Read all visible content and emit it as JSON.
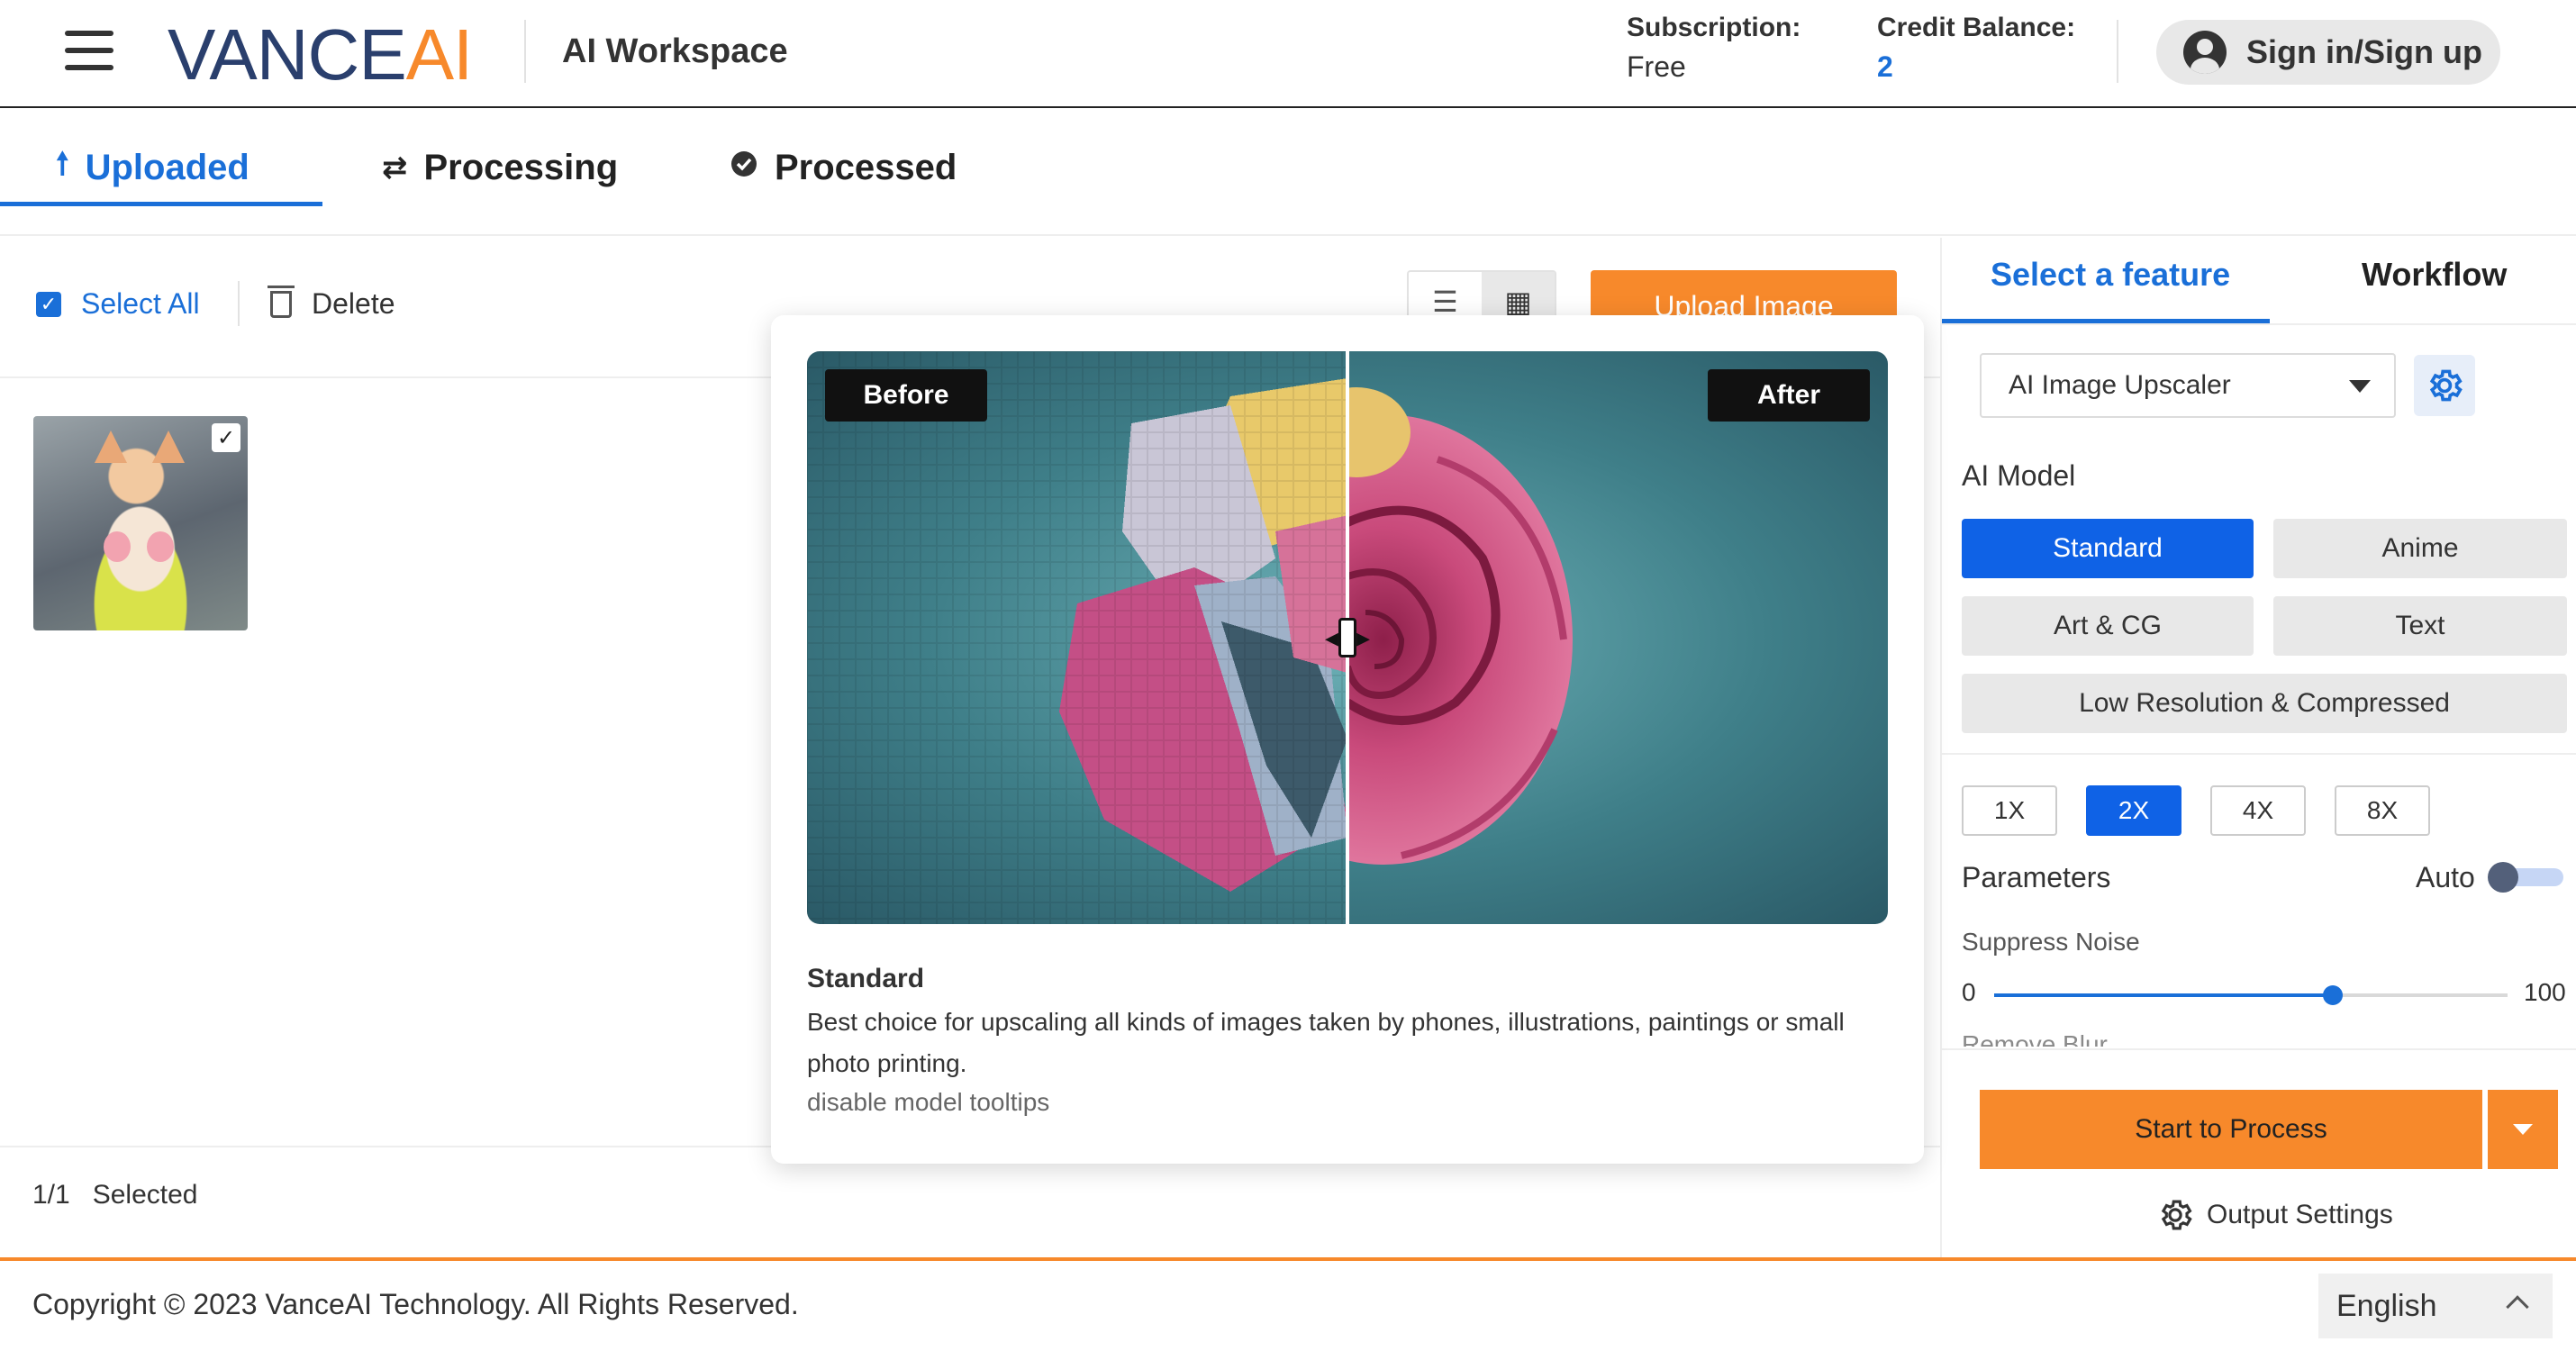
{
  "header": {
    "logo_main": "VANCE",
    "logo_accent": "AI",
    "workspace": "AI Workspace",
    "subscription_label": "Subscription:",
    "subscription_value": "Free",
    "credit_label": "Credit Balance:",
    "credit_value": "2",
    "signin_label": "Sign in/Sign up"
  },
  "tabs": [
    {
      "label": "Uploaded",
      "icon": "upload-arrow-icon",
      "active": true
    },
    {
      "label": "Processing",
      "icon": "refresh-icon",
      "active": false
    },
    {
      "label": "Processed",
      "icon": "check-circle-icon",
      "active": false
    }
  ],
  "toolbar": {
    "select_all": "Select All",
    "delete": "Delete",
    "upload": "Upload Image"
  },
  "gallery": {
    "selected_count": "1/1",
    "selected_label": "Selected"
  },
  "sidebar": {
    "tabs": [
      "Select a feature",
      "Workflow"
    ],
    "feature": "AI Image Upscaler",
    "ai_model_label": "AI Model",
    "models": [
      "Standard",
      "Anime",
      "Art & CG",
      "Text",
      "Low Resolution & Compressed"
    ],
    "selected_model": "Standard",
    "scales": [
      "1X",
      "2X",
      "4X",
      "8X"
    ],
    "selected_scale": "2X",
    "parameters_label": "Parameters",
    "auto_label": "Auto",
    "suppress_noise_label": "Suppress Noise",
    "slider_min": "0",
    "slider_max": "100",
    "suppress_noise_value": 66,
    "remove_blur_label": "Remove Blur",
    "process_button": "Start to Process",
    "output_settings": "Output Settings"
  },
  "tooltip": {
    "before_label": "Before",
    "after_label": "After",
    "title": "Standard",
    "description": "Best choice for upscaling all kinds of images taken by phones, illustrations, paintings or small photo printing.",
    "disable_link": "disable model tooltips"
  },
  "footer": {
    "copyright": "Copyright © 2023 VanceAI Technology. All Rights Reserved.",
    "language": "English"
  },
  "colors": {
    "brand_blue": "#1a6fd8",
    "brand_orange": "#f7892b",
    "logo_navy": "#2a3f6d",
    "selected_blue": "#0f62e6"
  }
}
